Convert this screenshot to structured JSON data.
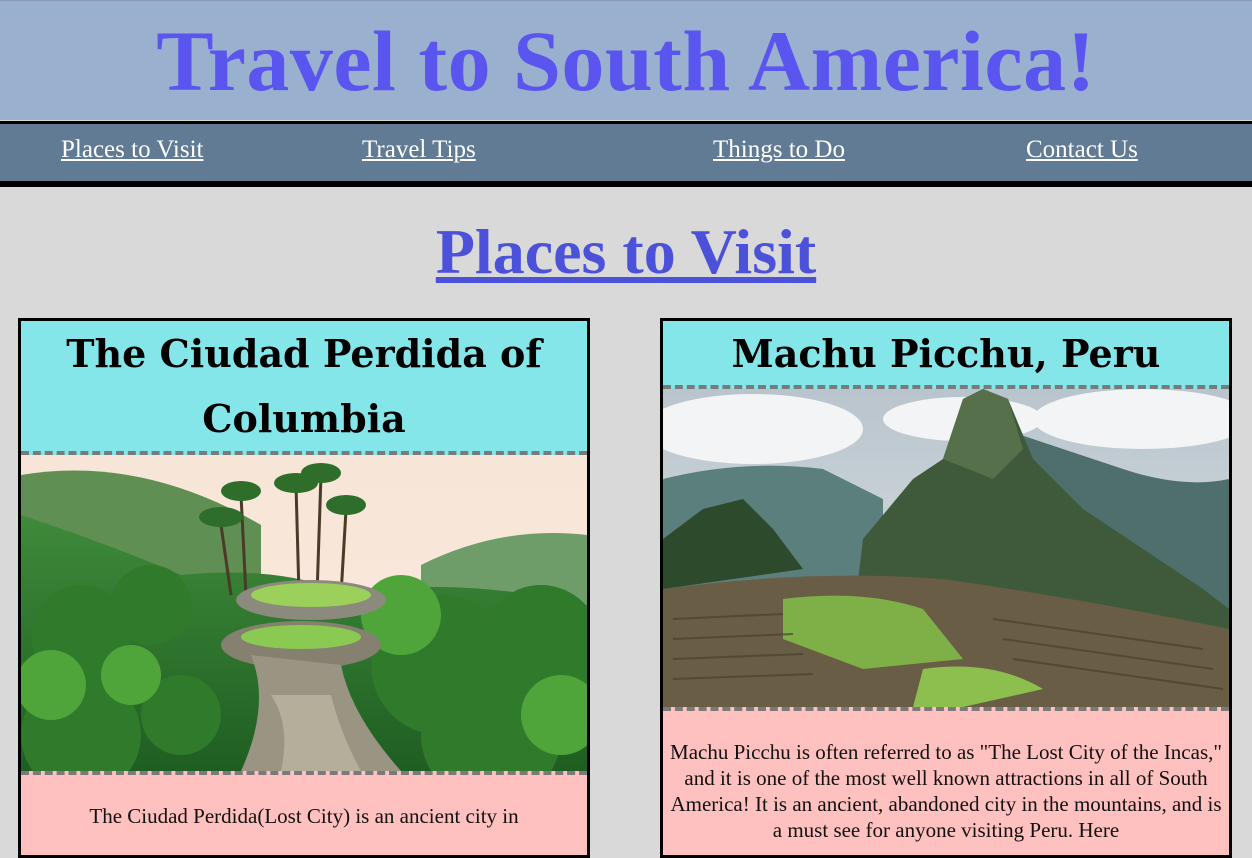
{
  "site": {
    "title": "Travel to South America!"
  },
  "nav": {
    "items": [
      "Places to Visit",
      "Travel Tips",
      "Things to Do",
      "Contact Us"
    ]
  },
  "main": {
    "section_title": "Places to Visit",
    "cards": [
      {
        "title": "The Ciudad Perdida of Columbia",
        "image": "ciudad-perdida-photo",
        "text": "The Ciudad Perdida(Lost City) is an ancient city in"
      },
      {
        "title": "Machu Picchu, Peru",
        "image": "machu-picchu-photo",
        "text": "Machu Picchu is often referred to as \"The Lost City of the Incas,\" and it is one of the most well known attractions in all of South America! It is an ancient, abandoned city in the mountains, and is a must see for anyone visiting Peru. Here"
      }
    ]
  },
  "colors": {
    "header_bg": "#9ab0cf",
    "title_color": "#5b55f0",
    "nav_bg": "#617b94",
    "section_title_color": "#4b52d9",
    "card_head_bg": "#85e6ea",
    "card_body_bg": "#ffc0c0",
    "page_bg": "#d9d9d9"
  }
}
